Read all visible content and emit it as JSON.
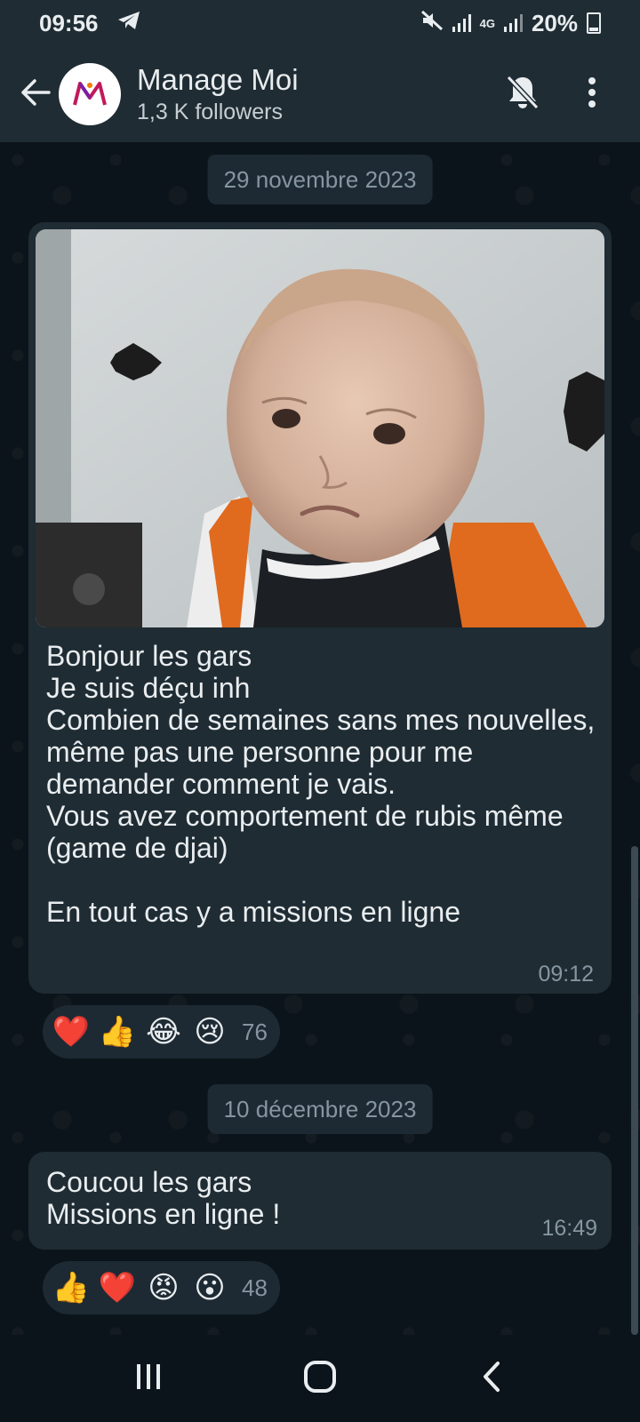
{
  "status_bar": {
    "time": "09:56",
    "battery": "20%",
    "network": "4G"
  },
  "header": {
    "title": "Manage Moi",
    "subtitle": "1,3 K followers",
    "icons": [
      "arrow-left-icon",
      "bell-off-icon",
      "more-vertical-icon"
    ]
  },
  "messages": [
    {
      "date": "29 novembre 2023",
      "has_photo": true,
      "text": "Bonjour les gars\nJe suis déçu inh\nCombien de semaines sans mes nouvelles, même pas une personne pour me demander comment je vais.\nVous avez comportement de rubis même (game de djai)\n\nEn tout cas y a missions en ligne",
      "time": "09:12",
      "reactions": [
        "❤️",
        "👍",
        "😂",
        "😢"
      ],
      "reaction_count": "76"
    },
    {
      "date": "10 décembre 2023",
      "has_photo": false,
      "text": "Coucou les gars\nMissions en ligne !",
      "time": "16:49",
      "reactions": [
        "👍",
        "❤️",
        "😡",
        "😮"
      ],
      "reaction_count": "48"
    }
  ],
  "colors": {
    "background": "#0b141a",
    "bar": "#1f2c34",
    "bubble": "#1f2c34",
    "meta_text": "#8696a0"
  }
}
